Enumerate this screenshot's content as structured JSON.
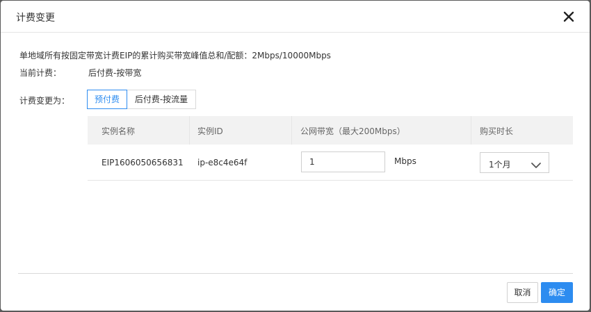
{
  "dialog": {
    "title": "计费变更",
    "close_icon": "close-icon"
  },
  "info": {
    "peak_notice": "单地域所有按固定带宽计费EIP的累计购买带宽峰值总和/配额：2Mbps/10000Mbps",
    "current_label": "当前计费：",
    "current_value": "后付费-按带宽",
    "change_label": "计费变更为："
  },
  "billing_options": [
    {
      "label": "预付费",
      "selected": true
    },
    {
      "label": "后付费-按流量",
      "selected": false
    }
  ],
  "table": {
    "headers": [
      "实例名称",
      "实例ID",
      "公网带宽（最大200Mbps）",
      "购买时长"
    ],
    "rows": [
      {
        "name": "EIP1606050656831",
        "id": "ip-e8c4e64f",
        "bandwidth_value": "1",
        "bandwidth_unit": "Mbps",
        "duration": "1个月"
      }
    ]
  },
  "footer": {
    "cancel_label": "取消",
    "ok_label": "确定"
  },
  "colors": {
    "accent": "#2d8cf0",
    "header_bg": "#f2f2f2"
  }
}
